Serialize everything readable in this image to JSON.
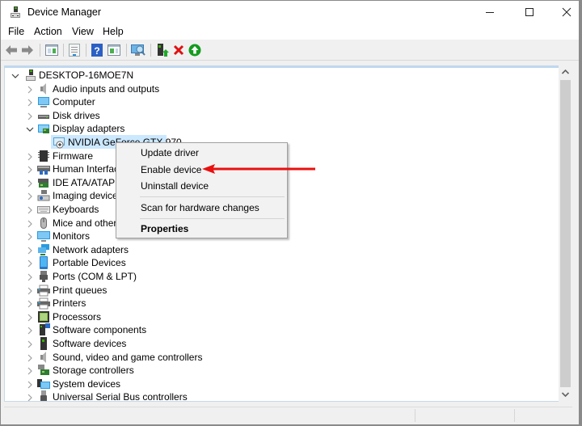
{
  "window": {
    "title": "Device Manager",
    "controls": {
      "minimize": "minimize",
      "maximize": "maximize",
      "close": "close"
    }
  },
  "menubar": [
    "File",
    "Action",
    "View",
    "Help"
  ],
  "toolbar": {
    "buttons": [
      "back",
      "forward",
      "show-hide-console-tree",
      "properties",
      "help",
      "show-action-pane",
      "scan-for-hardware-changes",
      "update-driver",
      "uninstall-device",
      "enable-device"
    ]
  },
  "tree": {
    "root": "DESKTOP-16MOE7N",
    "categories": [
      {
        "label": "Audio inputs and outputs",
        "icon": "speaker-icon",
        "expanded": false
      },
      {
        "label": "Computer",
        "icon": "computer-icon",
        "expanded": false
      },
      {
        "label": "Disk drives",
        "icon": "disk-drive-icon",
        "expanded": false
      },
      {
        "label": "Display adapters",
        "icon": "display-adapter-icon",
        "expanded": true,
        "children": [
          {
            "label": "NVIDIA GeForce GTX 970",
            "icon": "disabled-display-adapter-icon",
            "selected": true
          }
        ]
      },
      {
        "label": "Firmware",
        "icon": "firmware-icon",
        "expanded": false
      },
      {
        "label": "Human Interface Devices",
        "icon": "hid-icon",
        "expanded": false
      },
      {
        "label": "IDE ATA/ATAPI controllers",
        "icon": "ide-controller-icon",
        "expanded": false
      },
      {
        "label": "Imaging devices",
        "icon": "camera-icon",
        "expanded": false
      },
      {
        "label": "Keyboards",
        "icon": "keyboard-icon",
        "expanded": false
      },
      {
        "label": "Mice and other pointing devices",
        "icon": "mouse-icon",
        "expanded": false
      },
      {
        "label": "Monitors",
        "icon": "monitor-icon",
        "expanded": false
      },
      {
        "label": "Network adapters",
        "icon": "network-adapter-icon",
        "expanded": false
      },
      {
        "label": "Portable Devices",
        "icon": "portable-device-icon",
        "expanded": false
      },
      {
        "label": "Ports (COM & LPT)",
        "icon": "port-icon",
        "expanded": false
      },
      {
        "label": "Print queues",
        "icon": "printer-icon",
        "expanded": false
      },
      {
        "label": "Printers",
        "icon": "printer-icon",
        "expanded": false
      },
      {
        "label": "Processors",
        "icon": "processor-icon",
        "expanded": false
      },
      {
        "label": "Software components",
        "icon": "software-component-icon",
        "expanded": false
      },
      {
        "label": "Software devices",
        "icon": "software-device-icon",
        "expanded": false
      },
      {
        "label": "Sound, video and game controllers",
        "icon": "speaker-icon",
        "expanded": false
      },
      {
        "label": "Storage controllers",
        "icon": "storage-controller-icon",
        "expanded": false
      },
      {
        "label": "System devices",
        "icon": "system-devices-icon",
        "expanded": false
      },
      {
        "label": "Universal Serial Bus controllers",
        "icon": "usb-icon",
        "expanded": false
      }
    ]
  },
  "context_menu": {
    "items": [
      "Update driver",
      "Enable device",
      "Uninstall device",
      "Scan for hardware changes",
      "Properties"
    ],
    "default_item": "Properties",
    "highlighted_by_annotation": "Enable device"
  },
  "annotation": {
    "type": "arrow",
    "color": "#e81010",
    "points_to": "Enable device"
  },
  "scrollbar": {
    "vertical_visible_fraction": 0.95
  },
  "colors": {
    "selection": "#cce8ff",
    "tree_border_top": "#bfd8ee"
  }
}
